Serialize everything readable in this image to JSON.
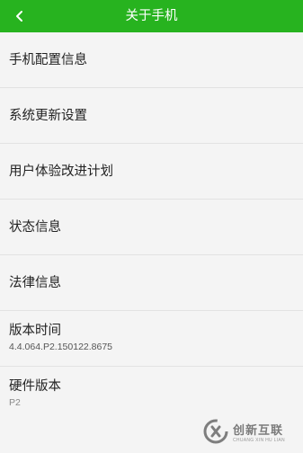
{
  "header": {
    "title": "关于手机",
    "back_icon": "chevron-left-icon",
    "color": "#27b31f"
  },
  "settings": {
    "items": [
      {
        "label": "手机配置信息"
      },
      {
        "label": "系统更新设置"
      },
      {
        "label": "用户体验改进计划"
      },
      {
        "label": "状态信息"
      },
      {
        "label": "法律信息"
      },
      {
        "label": "版本时间",
        "value": "4.4.064.P2.150122.8675"
      },
      {
        "label": "硬件版本",
        "value": "P2"
      }
    ]
  },
  "watermark": {
    "brand": "创新互联",
    "sub": "CHUANG XIN HU LIAN"
  }
}
